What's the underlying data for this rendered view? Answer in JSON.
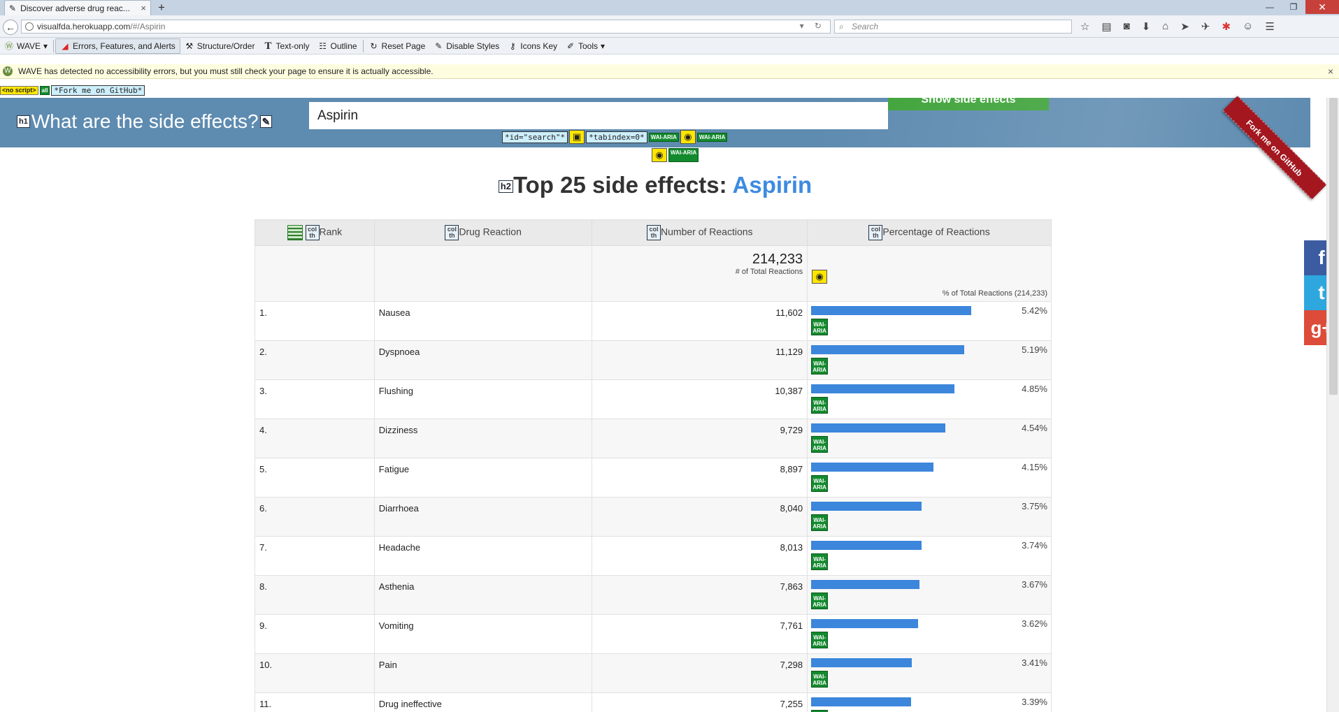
{
  "browser": {
    "tab_title": "Discover adverse drug reac...",
    "tab_close": "×",
    "new_tab": "+",
    "url_host": "visualfda.herokuapp.com",
    "url_path": "/#/Aspirin",
    "search_placeholder": "Search",
    "win_min": "—",
    "win_max": "❐",
    "win_close": "✕"
  },
  "wave_toolbar": {
    "wave_label": "WAVE",
    "errors": "Errors, Features, and Alerts",
    "structure": "Structure/Order",
    "text_only": "Text-only",
    "outline": "Outline",
    "reset": "Reset Page",
    "disable_styles": "Disable Styles",
    "icons_key": "Icons Key",
    "tools": "Tools"
  },
  "notice": {
    "text": "WAVE has detected no accessibility errors, but you must still check your page to ensure it is actually accessible.",
    "close": "×"
  },
  "wave_annotations": {
    "noscript": "<no script>",
    "fork_label": "*Fork me on GitHub*",
    "search_id": "*id=\"search\"*",
    "tabindex": "*tabindex=0*",
    "wai_aria": "WAI-ARIA",
    "h1_tag": "h1",
    "h2_tag": "h2",
    "col_th": "col th"
  },
  "header": {
    "title": "What are the side effects?",
    "search_value": "Aspirin",
    "show_button": "Show side effects",
    "ribbon": "Fork me on GitHub"
  },
  "results": {
    "heading_prefix": "Top 25 side effects: ",
    "drug": "Aspirin",
    "columns": [
      "Rank",
      "Drug Reaction",
      "Number of Reactions",
      "Percentage of Reactions"
    ],
    "total": "214,233",
    "total_label": "# of Total Reactions",
    "pct_total_label": "% of Total Reactions (214,233)",
    "rows": [
      {
        "rank": "1.",
        "reaction": "Nausea",
        "count": "11,602",
        "pct_label": "5.42%",
        "pct": 5.42
      },
      {
        "rank": "2.",
        "reaction": "Dyspnoea",
        "count": "11,129",
        "pct_label": "5.19%",
        "pct": 5.19
      },
      {
        "rank": "3.",
        "reaction": "Flushing",
        "count": "10,387",
        "pct_label": "4.85%",
        "pct": 4.85
      },
      {
        "rank": "4.",
        "reaction": "Dizziness",
        "count": "9,729",
        "pct_label": "4.54%",
        "pct": 4.54
      },
      {
        "rank": "5.",
        "reaction": "Fatigue",
        "count": "8,897",
        "pct_label": "4.15%",
        "pct": 4.15
      },
      {
        "rank": "6.",
        "reaction": "Diarrhoea",
        "count": "8,040",
        "pct_label": "3.75%",
        "pct": 3.75
      },
      {
        "rank": "7.",
        "reaction": "Headache",
        "count": "8,013",
        "pct_label": "3.74%",
        "pct": 3.74
      },
      {
        "rank": "8.",
        "reaction": "Asthenia",
        "count": "7,863",
        "pct_label": "3.67%",
        "pct": 3.67
      },
      {
        "rank": "9.",
        "reaction": "Vomiting",
        "count": "7,761",
        "pct_label": "3.62%",
        "pct": 3.62
      },
      {
        "rank": "10.",
        "reaction": "Pain",
        "count": "7,298",
        "pct_label": "3.41%",
        "pct": 3.41
      },
      {
        "rank": "11.",
        "reaction": "Drug ineffective",
        "count": "7,255",
        "pct_label": "3.39%",
        "pct": 3.39
      }
    ]
  },
  "social": {
    "facebook": "f",
    "twitter": "t",
    "google": "g+"
  },
  "colors": {
    "accent": "#3d8be0",
    "bar": "#3c86dc",
    "hero": "#5e8bb0",
    "ribbon": "#a4171f"
  }
}
